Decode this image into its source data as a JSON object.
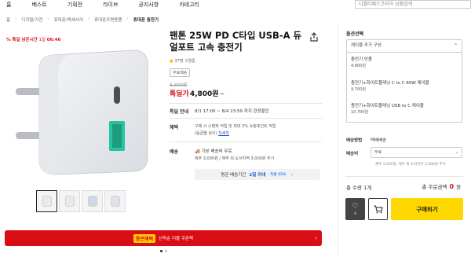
{
  "nav": {
    "items": [
      "홈",
      "베스트",
      "기획전",
      "라이브",
      "공지사항",
      "카테고리"
    ],
    "search_placeholder": "디월티패드코리아 상품검색"
  },
  "breadcrumb": [
    "홈",
    "디지털/가전",
    "휴대폰/액세서리",
    "휴대폰주변용품",
    "휴대폰 충전기"
  ],
  "special": {
    "prefix": "% 특딜 남은시간",
    "days": "1일",
    "time": "06:46"
  },
  "product": {
    "title": "팬톤 25W PD C타입 USB-A 듀얼포트 고속 충전기",
    "rating_text": "37명 구경중",
    "free_badge": "무료배송",
    "original_price": "6,800원",
    "price_label": "특딜가",
    "price": "4,800원",
    "price_suffix": "~"
  },
  "info": {
    "special_label": "특딜 안내",
    "special_text": "8/1 17:00 ~ 8/4 23:59 까지 한정할인",
    "benefit_label": "혜택",
    "benefit_line1": "구매 시 스탠퍼 적립 및 최대 3% 쇼핑포인트 적립",
    "benefit_line2": "(등급별 상이)",
    "benefit_link": "자세히",
    "delivery_label": "배송",
    "delivery_line1": "기본 배송비 무료",
    "delivery_line2": "제주 3,000원 / 제주 외 도서지역 3,000원 추가",
    "avg_label": "평균 배송기간",
    "avg_value": "2일 이내",
    "avg_tag": "특출 93%"
  },
  "options": {
    "title": "옵션선택",
    "select_label": "케이블 추가 구성",
    "items": [
      {
        "name": "충전기 단품",
        "price": "4,800원"
      },
      {
        "name": "충전기+화이트플레닛 C to C 60W 케이블",
        "price": "9,700원"
      },
      {
        "name": "충전기+화이트플레닛 USB to C 케이블",
        "price": "10,700원"
      }
    ]
  },
  "shipping": {
    "method_label": "배송방법",
    "method_value": "택배배송",
    "fee_label": "배송비",
    "fee_value": "무료",
    "fee_note": "제주 3,000원, 제주 외 도서지역 3,000원 추가"
  },
  "totals": {
    "qty_label": "총 수량 1개",
    "amount_label": "총 주문금액",
    "amount_value": "0",
    "amount_unit": "원"
  },
  "actions": {
    "like_count": "4",
    "buy_label": "구매하기"
  },
  "banner": {
    "badge": "통큰혜택",
    "text": "선착순 더블 쿠폰팩"
  },
  "colors": {
    "accent_red": "#d90e15",
    "buy_yellow": "#ffd800",
    "link_blue": "#1a55c5"
  }
}
